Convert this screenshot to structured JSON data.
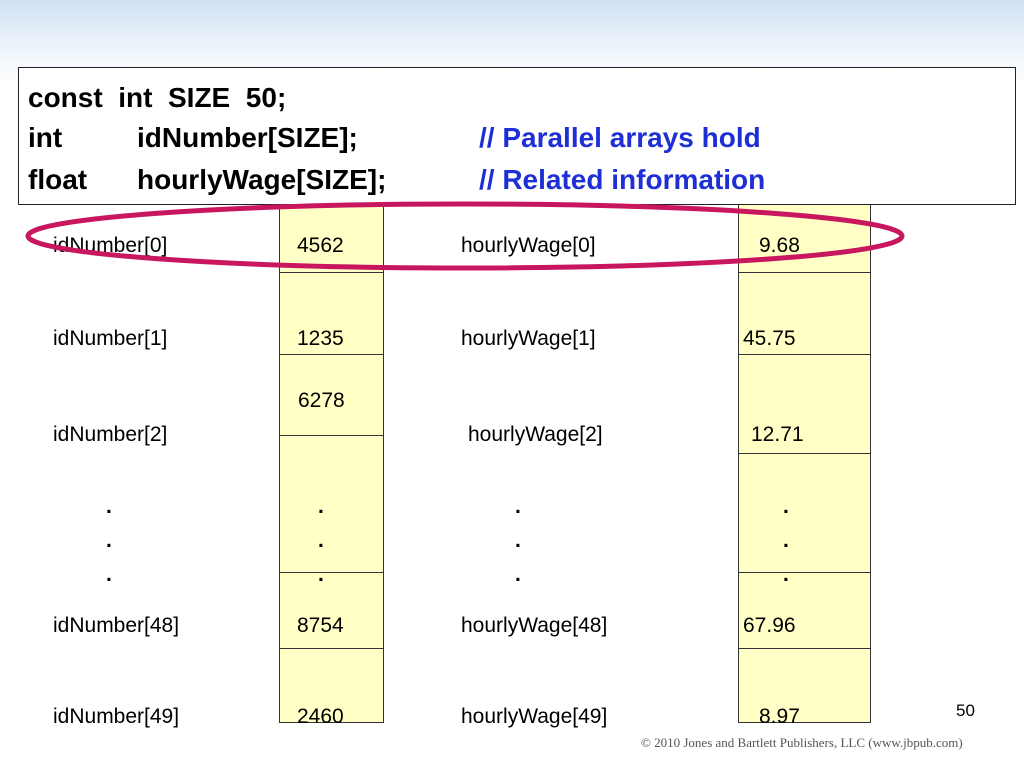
{
  "code": {
    "line1": "const  int  SIZE  50;",
    "line2_type": "int",
    "line2_decl": "idNumber[SIZE];",
    "line2_comment": "// Parallel arrays hold",
    "line3_type": "float",
    "line3_decl": "hourlyWage[SIZE];",
    "line3_comment": "// Related information"
  },
  "rows": [
    {
      "id_label": "idNumber[0]",
      "id_value": "4562",
      "wage_label": "hourlyWage[0]",
      "wage_value": "9.68"
    },
    {
      "id_label": "idNumber[1]",
      "id_value": "1235",
      "wage_label": "hourlyWage[1]",
      "wage_value": "45.75"
    },
    {
      "id_label": "idNumber[2]",
      "id_value": "6278",
      "wage_label": "hourlyWage[2]",
      "wage_value": "12.71"
    },
    {
      "id_label": "idNumber[48]",
      "id_value": "8754",
      "wage_label": "hourlyWage[48]",
      "wage_value": "67.96"
    },
    {
      "id_label": "idNumber[49]",
      "id_value": "2460",
      "wage_label": "hourlyWage[49]",
      "wage_value": "8.97"
    }
  ],
  "ellipsis_dot": ".",
  "page_number": "50",
  "copyright": "© 2010 Jones and Bartlett Publishers, LLC (www.jbpub.com)",
  "colors": {
    "comment": "#1f2fd6",
    "highlight_ellipse": "#c8175f",
    "array_cell": "#ffffc6"
  }
}
